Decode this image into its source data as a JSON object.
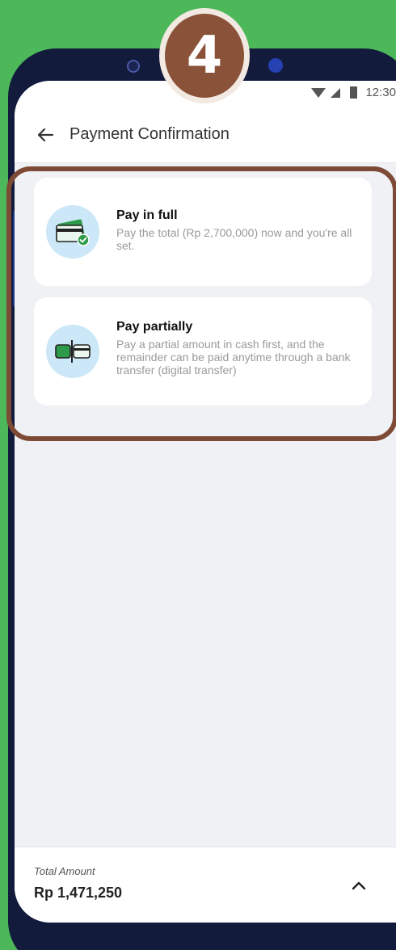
{
  "step_badge": "4",
  "status_bar": {
    "time": "12:30"
  },
  "header": {
    "title": "Payment Confirmation"
  },
  "options": [
    {
      "title": "Pay in full",
      "description": "Pay the total  (Rp 2,700,000) now and you're all set.",
      "icon": "credit-card-check-icon"
    },
    {
      "title": "Pay partially",
      "description": "Pay a partial amount in cash first, and the remainder can be paid anytime through a bank transfer (digital transfer)",
      "icon": "split-payment-icon"
    }
  ],
  "footer": {
    "total_label": "Total Amount",
    "total_value": "Rp 1,471,250"
  },
  "colors": {
    "background": "#4cb85a",
    "highlight": "#7d4a35",
    "icon_bg": "#cbe7f8",
    "card_green": "#2e9b4a"
  }
}
